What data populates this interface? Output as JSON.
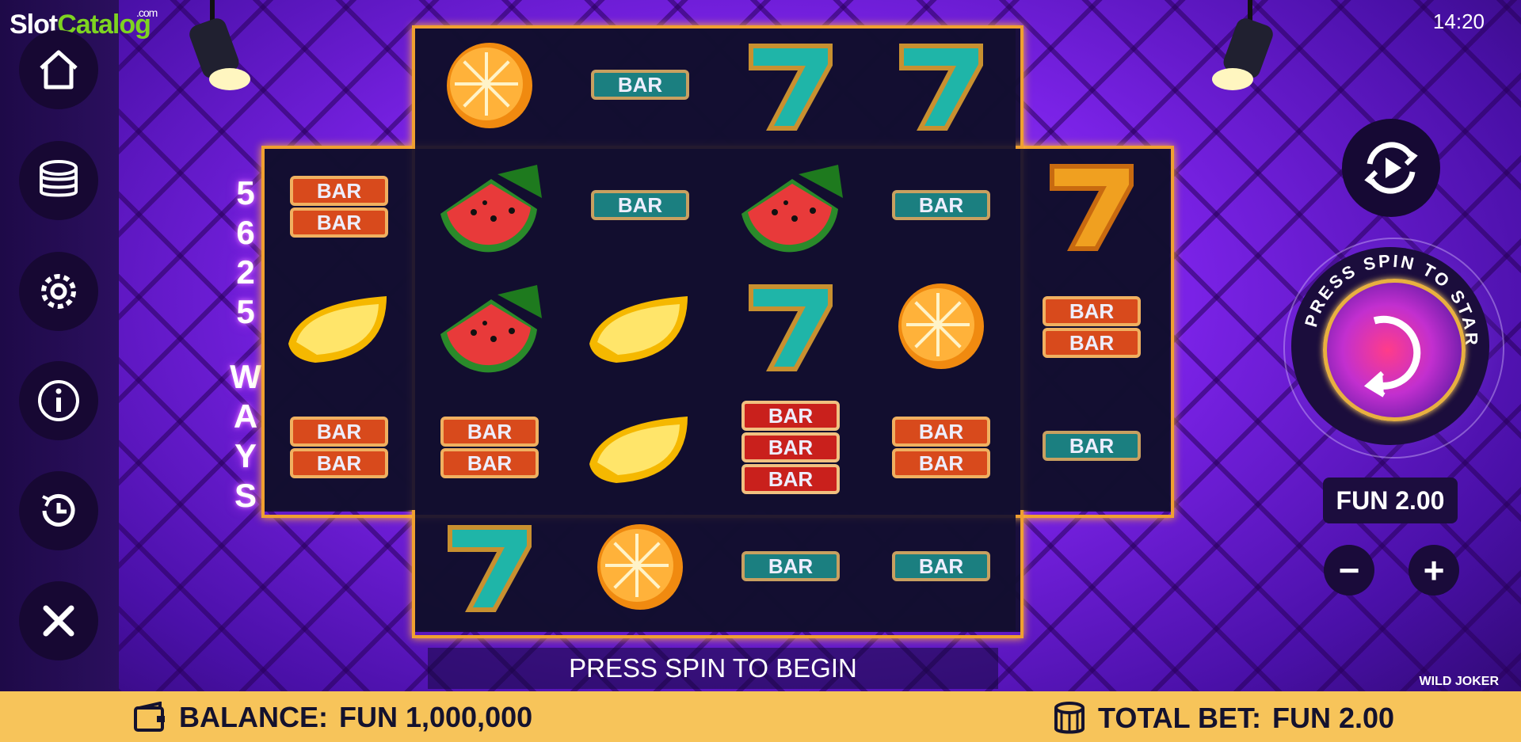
{
  "brand": {
    "slot": "Slot",
    "catalog": "Catalog",
    "com": ".com"
  },
  "clock": "14:20",
  "sidebar": {
    "icons": [
      "home-icon",
      "coins-icon",
      "gear-icon",
      "info-icon",
      "history-icon",
      "close-icon"
    ]
  },
  "ways": {
    "number": [
      "5",
      "6",
      "2",
      "5"
    ],
    "word": [
      "W",
      "A",
      "Y",
      "S"
    ]
  },
  "reels": {
    "symbols": [
      [
        "bar2",
        "lemon",
        "bar2"
      ],
      [
        "orange",
        "watermelon",
        "watermelon",
        "bar2",
        "seven-teal"
      ],
      [
        "bar-teal",
        "bar-teal",
        "lemon",
        "lemon",
        "orange"
      ],
      [
        "seven-teal",
        "watermelon",
        "seven-teal",
        "bar3",
        "bar-teal"
      ],
      [
        "seven-teal",
        "bar-teal",
        "orange",
        "bar2",
        "bar-teal"
      ],
      [
        "seven-gold",
        "bar2",
        "bar-teal"
      ]
    ],
    "bar_label": "BAR"
  },
  "banner": "PRESS SPIN TO BEGIN",
  "spin": {
    "curved_text": "PRESS SPIN TO START"
  },
  "bet_display": "FUN 2.00",
  "controls": {
    "minus": "−",
    "plus": "+"
  },
  "game_name": "WILD JOKER",
  "bottom": {
    "balance_label": "BALANCE:",
    "balance_value": "FUN 1,000,000",
    "totalbet_label": "TOTAL BET:",
    "totalbet_value": "FUN 2.00"
  },
  "colors": {
    "accent_gold": "#f0a030",
    "bottom_bar": "#f7c45a",
    "teal_seven": "#1fb5a8",
    "bar_red": "#d84a1c"
  }
}
